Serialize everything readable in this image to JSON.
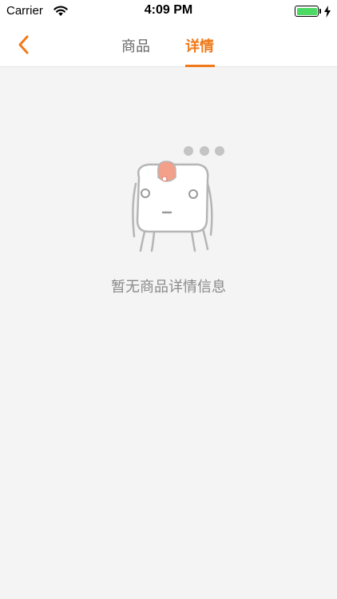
{
  "status_bar": {
    "carrier": "Carrier",
    "time": "4:09 PM",
    "battery_level": 1.0,
    "icons": [
      "wifi-icon",
      "battery-icon",
      "charging-bolt-icon"
    ]
  },
  "nav": {
    "back_icon": "chevron-left-icon",
    "tabs": [
      {
        "label": "商品",
        "active": false
      },
      {
        "label": "详情",
        "active": true
      }
    ],
    "accent_color": "#f07a1a"
  },
  "empty_state": {
    "illustration": "empty-mascot-illustration",
    "message": "暂无商品详情信息"
  },
  "colors": {
    "background": "#f4f4f4",
    "header": "#ffffff",
    "text_muted": "#8a8a8a",
    "battery": "#4cd964"
  }
}
